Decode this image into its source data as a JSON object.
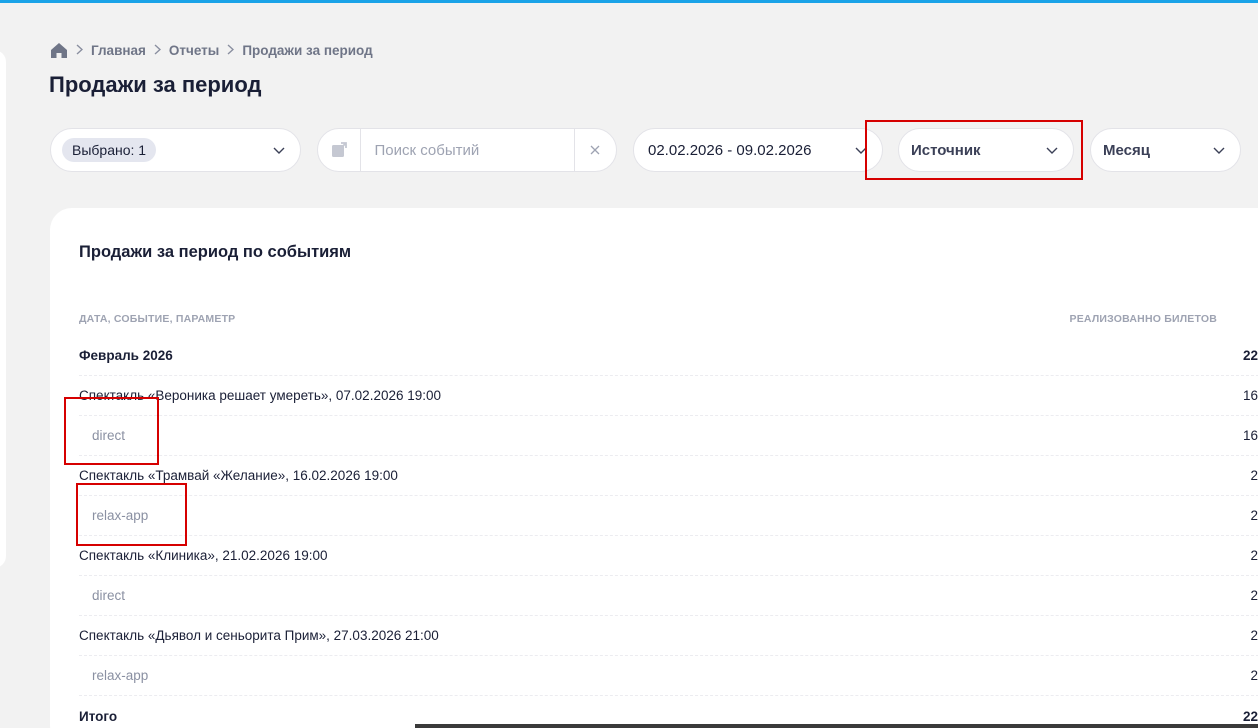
{
  "breadcrumb": {
    "items": [
      "Главная",
      "Отчеты"
    ],
    "current": "Продажи за период"
  },
  "page_title": "Продажи за период",
  "filters": {
    "selected_chip": "Выбрано: 1",
    "search_placeholder": "Поиск событий",
    "date_range": "02.02.2026 - 09.02.2026",
    "source": "Источник",
    "period": "Месяц"
  },
  "report": {
    "title": "Продажи за период по событиям",
    "col_left": "ДАТА, СОБЫТИЕ, ПАРАМЕТР",
    "col_right": "РЕАЛИЗОВАННО БИЛЕТОВ",
    "rows": [
      {
        "label": "Февраль 2026",
        "value": "22"
      },
      {
        "label": "Спектакль «Вероника решает умереть», 07.02.2026 19:00",
        "value": "16"
      },
      {
        "label": "direct",
        "value": "16"
      },
      {
        "label": "Спектакль «Трамвай «Желание», 16.02.2026 19:00",
        "value": "2"
      },
      {
        "label": "relax-app",
        "value": "2"
      },
      {
        "label": "Спектакль «Клиника», 21.02.2026 19:00",
        "value": "2"
      },
      {
        "label": "direct",
        "value": "2"
      },
      {
        "label": "Спектакль «Дьявол и сеньорита Прим», 27.03.2026 21:00",
        "value": "2"
      },
      {
        "label": "relax-app",
        "value": "2"
      },
      {
        "label": "Итого",
        "value": "22"
      }
    ]
  },
  "colors": {
    "accent_bar": "#1aa3e8",
    "highlight_box": "#d60000",
    "background": "#f2f2f2"
  }
}
